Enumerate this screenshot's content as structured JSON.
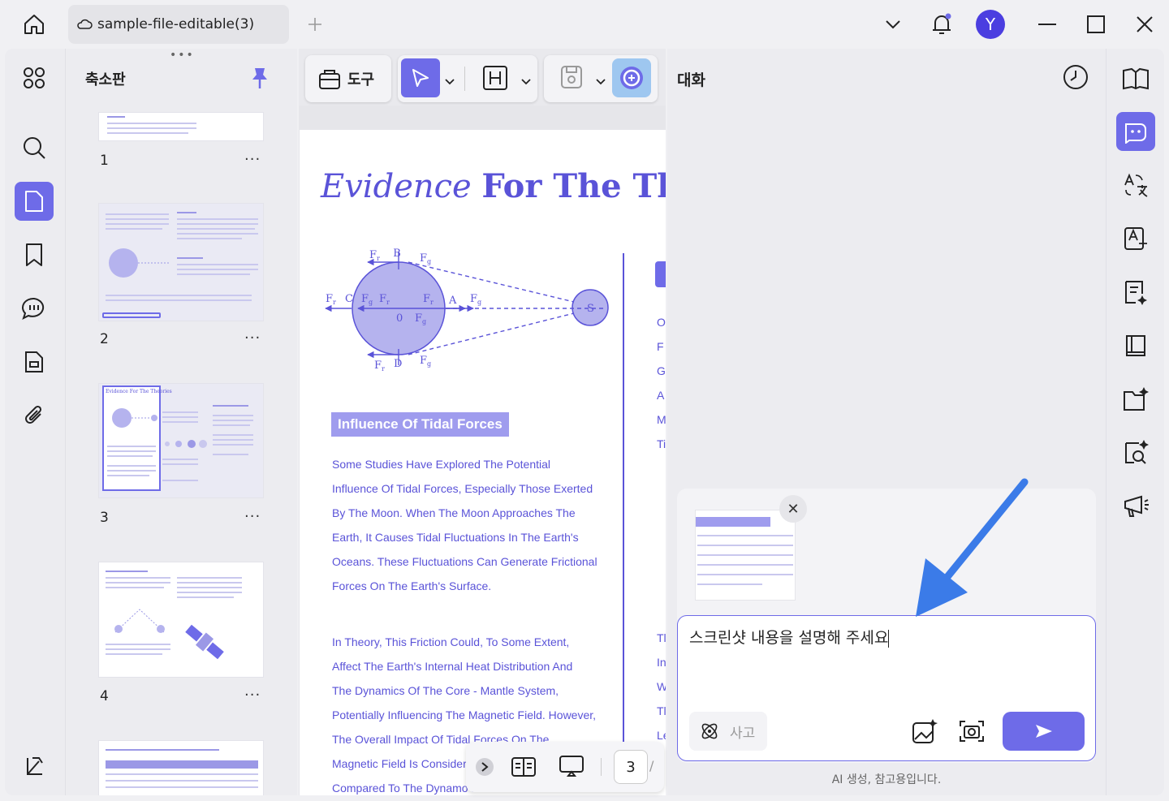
{
  "titlebar": {
    "tab_title": "sample-file-editable(3)",
    "avatar_letter": "Y"
  },
  "thumbnails": {
    "title": "축소판",
    "pages": [
      "1",
      "2",
      "3",
      "4"
    ],
    "more": "···"
  },
  "toolbar": {
    "tools_label": "도구"
  },
  "document": {
    "title_italic": "Evidence",
    "title_bold": "For The Theories",
    "section_heading": "Influence Of Tidal Forces",
    "paragraph1": [
      "Some Studies Have Explored The Potential",
      "Influence Of Tidal Forces, Especially Those Exerted",
      "By The Moon. When The Moon Approaches The",
      "Earth, It Causes Tidal Fluctuations In The Earth's",
      "Oceans. These Fluctuations Can Generate Frictional",
      "Forces On The Earth's Surface."
    ],
    "paragraph2": [
      "In Theory, This Friction Could, To Some Extent,",
      "Affect The Earth's Internal Heat Distribution And",
      "The Dynamics Of The Core - Mantle System,",
      "Potentially Influencing The Magnetic Field. However,",
      "The Overall Impact Of Tidal Forces On The",
      "Magnetic Field Is Considered",
      "Compared To The Dynamo Process."
    ],
    "col2_letters_top": [
      "O",
      "F",
      "G",
      "A",
      "M",
      "Ti"
    ],
    "col2_letters_bottom": [
      "Tl",
      "In",
      "W",
      "Tl",
      "Le"
    ],
    "diagram_labels": {
      "fr": "F",
      "fg": "F",
      "b": "B",
      "c": "C",
      "d": "D",
      "a": "A",
      "s": "S",
      "zero": "0"
    }
  },
  "pager": {
    "current_page": "3",
    "separator": "/"
  },
  "chat": {
    "title": "대화",
    "input_text": "스크린샷 내용을 설명해 주세요",
    "think_label": "사고",
    "disclaimer": "AI 생성, 참고용입니다.",
    "close_symbol": "✕"
  },
  "colors": {
    "accent": "#6e6be8",
    "doc_blue": "#5a53d8",
    "annotation_arrow": "#3b7be8"
  }
}
